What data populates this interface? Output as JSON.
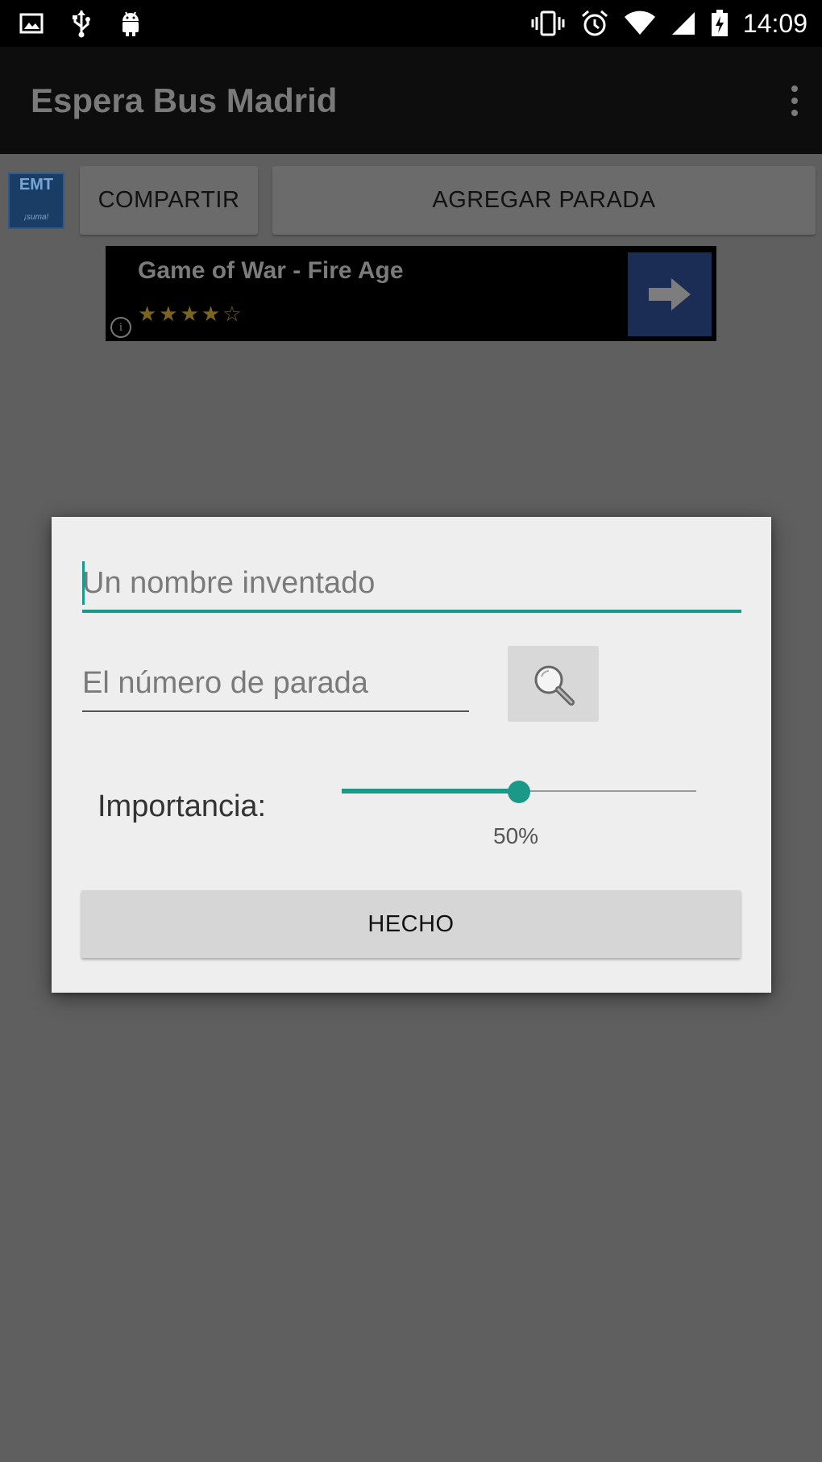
{
  "status_bar": {
    "time": "14:09",
    "left_icons": [
      "image-icon",
      "usb-icon",
      "android-icon"
    ],
    "right_icons": [
      "vibrate-icon",
      "alarm-icon",
      "wifi-icon",
      "signal-icon",
      "battery-charging-icon"
    ]
  },
  "action_bar": {
    "title": "Espera Bus Madrid",
    "overflow_icon": "overflow-menu-icon"
  },
  "toolbar": {
    "logo_text": "EMT",
    "logo_subtext": "¡suma!",
    "share_label": "COMPARTIR",
    "add_stop_label": "AGREGAR PARADA"
  },
  "ad": {
    "title": "Game of War - Fire Age",
    "rating": 4.5,
    "stars": "★★★★☆"
  },
  "dialog": {
    "name_placeholder": "Un nombre inventado",
    "stop_placeholder": "El número de parada",
    "importance_label": "Importancia:",
    "importance_value": 0.5,
    "importance_text": "50%",
    "done_label": "HECHO"
  },
  "colors": {
    "accent": "#1a9988",
    "dim_overlay": "#5f5f5f",
    "dialog_bg": "#eeeeee"
  }
}
